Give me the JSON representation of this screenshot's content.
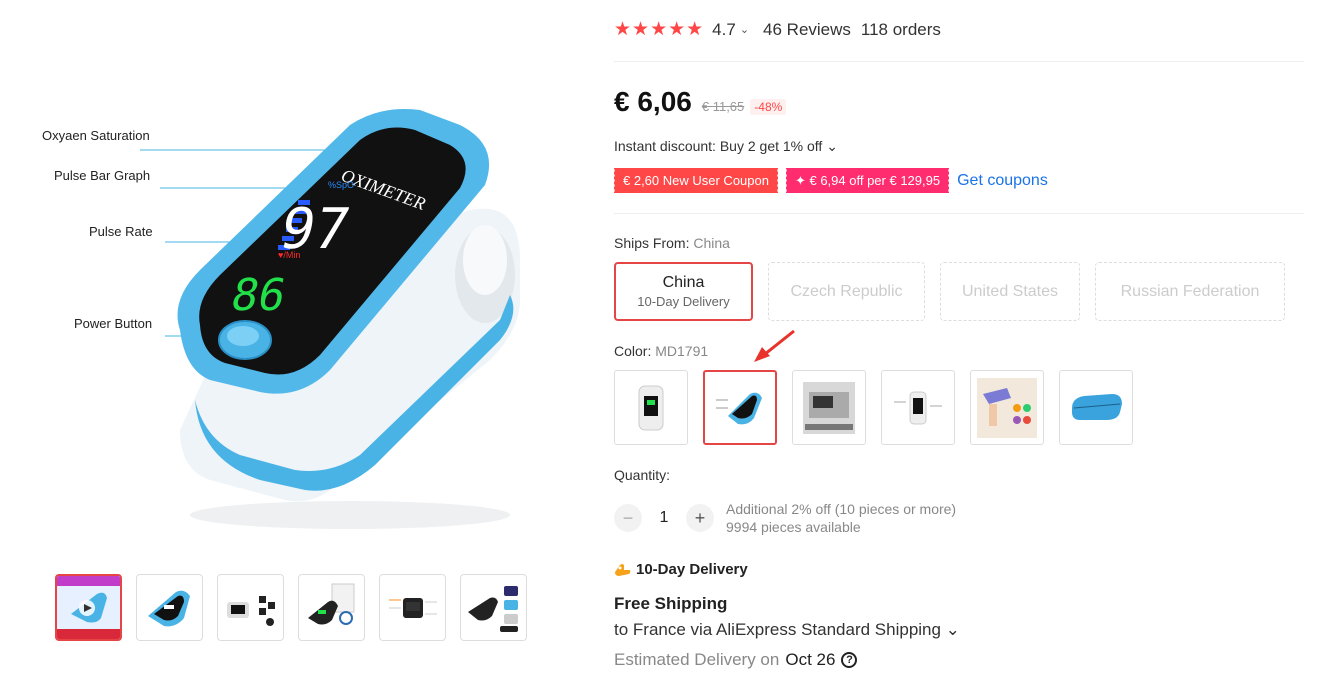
{
  "product": {
    "rating": {
      "stars": "★★★★★",
      "score": "4.7",
      "chevron": "⌄",
      "reviews": "46 Reviews",
      "orders": "118 orders"
    },
    "price": {
      "current": "€ 6,06",
      "original": "€ 11,65",
      "discount": "-48%"
    },
    "instant_discount": "Instant discount: Buy 2 get 1% off ⌄",
    "coupons": [
      {
        "label": "€ 2,60 New User Coupon"
      },
      {
        "label": "✦ € 6,94 off per € 129,95"
      }
    ],
    "get_coupons_label": "Get coupons",
    "ships_from": {
      "label": "Ships From: ",
      "value": "China",
      "options": [
        {
          "name": "China",
          "sub": "10-Day Delivery",
          "selected": true
        },
        {
          "name": "Czech Republic",
          "selected": false
        },
        {
          "name": "United States",
          "selected": false
        },
        {
          "name": "Russian Federation",
          "selected": false
        }
      ]
    },
    "color": {
      "label": "Color: ",
      "value": "MD1791"
    },
    "quantity": {
      "label": "Quantity:",
      "minus": "−",
      "plus": "+",
      "value": "1",
      "bulk_note": "Additional 2% off (10 pieces or more)",
      "available": "9994 pieces available"
    },
    "delivery": {
      "title": "10-Day Delivery",
      "free_shipping": "Free Shipping",
      "via": "to France via AliExpress Standard Shipping ⌄",
      "estimated_label": "Estimated Delivery on",
      "estimated_date": "Oct 26",
      "help_icon": "?"
    }
  },
  "image_labels": {
    "oxygen": "Oxyaen Saturation",
    "pulse_bar": "Pulse Bar Graph",
    "pulse_rate": "Pulse Rate",
    "power": "Power Button",
    "device_brand": "OXIMETER",
    "spo2_value": "97",
    "pr_value": "86",
    "spo2_unit": "%SpO",
    "pr_unit": "♥/Min"
  },
  "colors": {
    "accent": "#ff4747",
    "selected_border": "#e64545",
    "link": "#1a73e8",
    "device_blue": "#4ab3e6"
  }
}
